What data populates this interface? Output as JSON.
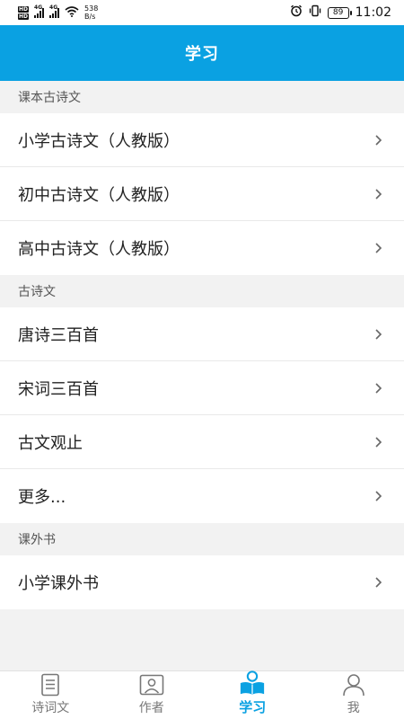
{
  "status_bar": {
    "hd1": "HD",
    "hd2": "HD",
    "sig1": "4G",
    "sig2": "4G",
    "speed_value": "538",
    "speed_unit": "B/s",
    "battery": "89",
    "time": "11:02"
  },
  "header": {
    "title": "学习"
  },
  "sections": [
    {
      "title": "课本古诗文",
      "items": [
        "小学古诗文（人教版）",
        "初中古诗文（人教版）",
        "高中古诗文（人教版）"
      ]
    },
    {
      "title": "古诗文",
      "items": [
        "唐诗三百首",
        "宋词三百首",
        "古文观止",
        "更多..."
      ]
    },
    {
      "title": "课外书",
      "items": [
        "小学课外书"
      ]
    }
  ],
  "nav": {
    "tabs": [
      "诗词文",
      "作者",
      "学习",
      "我"
    ],
    "active_index": 2
  },
  "colors": {
    "accent": "#0aa1e2",
    "background": "#f2f2f2"
  }
}
